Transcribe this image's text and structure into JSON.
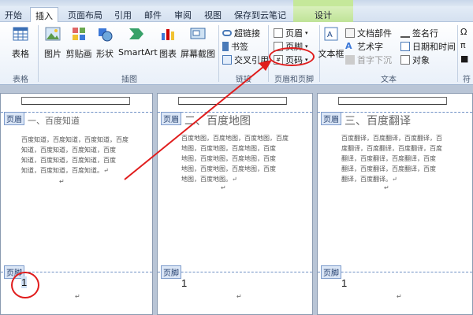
{
  "tabs": {
    "start": "开始",
    "insert": "插入",
    "layout": "页面布局",
    "references": "引用",
    "mailings": "邮件",
    "review": "审阅",
    "view": "视图",
    "save_cloud": "保存到云笔记",
    "design": "设计"
  },
  "ribbon": {
    "table": {
      "btn": "表格",
      "group": "表格"
    },
    "illustrations": {
      "picture": "图片",
      "clipart": "剪贴画",
      "shapes": "形状",
      "smartart": "SmartArt",
      "chart": "图表",
      "screenshot": "屏幕截图",
      "group": "插图"
    },
    "links": {
      "hyperlink": "超链接",
      "bookmark": "书签",
      "crossref": "交叉引用",
      "group": "链接"
    },
    "header_footer": {
      "header": "页眉",
      "footer": "页脚",
      "page_number": "页码",
      "group": "页眉和页脚"
    },
    "text": {
      "textbox": "文本框",
      "quickparts": "文档部件",
      "wordart": "艺术字",
      "dropcap": "首字下沉",
      "signature": "签名行",
      "datetime": "日期和时间",
      "object": "对象",
      "group": "文本"
    },
    "symbols": {
      "omega": "Ω",
      "sym2": "π",
      "sym3": "■",
      "group": "符"
    }
  },
  "doc": {
    "header_tag": "页眉",
    "footer_tag": "页脚",
    "pages": [
      {
        "title": "一、百度知道",
        "lines": [
          "百度知道，百度知道，百度知道，百度",
          "知道，百度知道，百度知道，百度",
          "知道，百度知道，百度知道，百度",
          "知道，百度知道，百度知道。↵"
        ],
        "page_number": "1"
      },
      {
        "title": "二、百度地图",
        "lines": [
          "百度地图，百度地图，百度地图，百度",
          "地图，百度地图，百度地图，百度",
          "地图，百度地图，百度地图，百度",
          "地图，百度地图，百度地图，百度",
          "地图，百度地图。↵"
        ],
        "page_number": "1"
      },
      {
        "title": "三、百度翻译",
        "lines": [
          "百度翻译，百度翻译，百度翻译，百",
          "度翻译，百度翻译，百度翻译，百度",
          "翻译，百度翻译，百度翻译，百度",
          "翻译，百度翻译，百度翻译，百度",
          "翻译，百度翻译。↵"
        ],
        "page_number": "1"
      }
    ],
    "para_mark": "↵"
  },
  "colors": {
    "annotation": "#e01c1c",
    "tag_border": "#7d9bcb"
  }
}
